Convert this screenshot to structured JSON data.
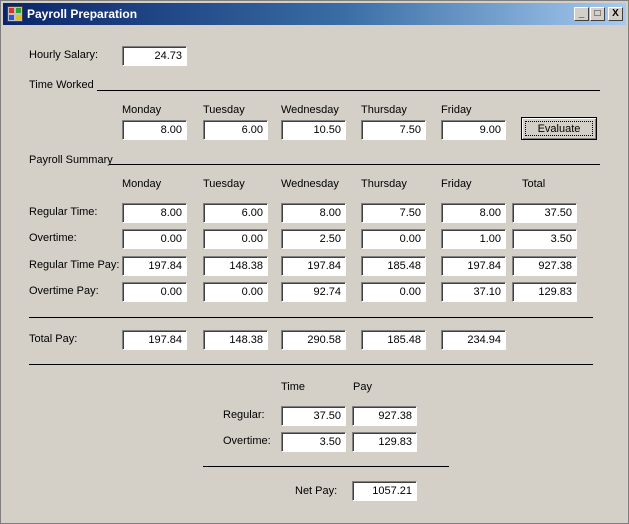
{
  "window": {
    "title": "Payroll Preparation",
    "controls": {
      "minimize": "_",
      "maximize": "□",
      "close": "X"
    }
  },
  "hourly_salary": {
    "label": "Hourly Salary:",
    "value": "24.73"
  },
  "time_worked": {
    "section_label": "Time Worked",
    "days": [
      "Monday",
      "Tuesday",
      "Wednesday",
      "Thursday",
      "Friday"
    ],
    "values": [
      "8.00",
      "6.00",
      "10.50",
      "7.50",
      "9.00"
    ],
    "evaluate_label": "Evaluate"
  },
  "summary": {
    "section_label": "Payroll Summary",
    "columns": [
      "Monday",
      "Tuesday",
      "Wednesday",
      "Thursday",
      "Friday",
      "Total"
    ],
    "rows": [
      {
        "label": "Regular Time:",
        "values": [
          "8.00",
          "6.00",
          "8.00",
          "7.50",
          "8.00",
          "37.50"
        ]
      },
      {
        "label": "Overtime:",
        "values": [
          "0.00",
          "0.00",
          "2.50",
          "0.00",
          "1.00",
          "3.50"
        ]
      },
      {
        "label": "Regular Time Pay:",
        "values": [
          "197.84",
          "148.38",
          "197.84",
          "185.48",
          "197.84",
          "927.38"
        ]
      },
      {
        "label": "Overtime Pay:",
        "values": [
          "0.00",
          "0.00",
          "92.74",
          "0.00",
          "37.10",
          "129.83"
        ]
      }
    ],
    "total_pay": {
      "label": "Total Pay:",
      "values": [
        "197.84",
        "148.38",
        "290.58",
        "185.48",
        "234.94"
      ]
    }
  },
  "totals": {
    "time_header": "Time",
    "pay_header": "Pay",
    "regular": {
      "label": "Regular:",
      "time": "37.50",
      "pay": "927.38"
    },
    "overtime": {
      "label": "Overtime:",
      "time": "3.50",
      "pay": "129.83"
    },
    "net_pay": {
      "label": "Net Pay:",
      "value": "1057.21"
    }
  }
}
